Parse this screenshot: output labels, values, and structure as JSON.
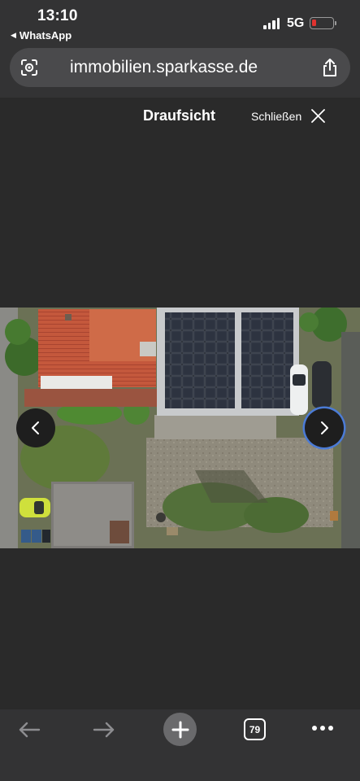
{
  "status_bar": {
    "time": "13:10",
    "back_app": "WhatsApp",
    "network": "5G",
    "icons": [
      "signal-icon",
      "battery-icon"
    ]
  },
  "browser": {
    "url": "immobilien.sparkasse.de",
    "icons": [
      "reader-icon",
      "share-icon"
    ]
  },
  "viewer": {
    "title": "Draufsicht",
    "close_label": "Schließen",
    "icons": [
      "close-icon",
      "chevron-left-icon",
      "chevron-right-icon"
    ]
  },
  "toolbar": {
    "tab_count": "79",
    "icons": [
      "back-arrow-icon",
      "forward-arrow-icon",
      "plus-icon",
      "tabs-icon",
      "more-icon"
    ]
  },
  "colors": {
    "chrome": "#333334",
    "pill": "#4a4a4c",
    "background": "#2a2a2a",
    "battery_low": "#e0322f",
    "focus_ring": "#4b7bd6"
  }
}
